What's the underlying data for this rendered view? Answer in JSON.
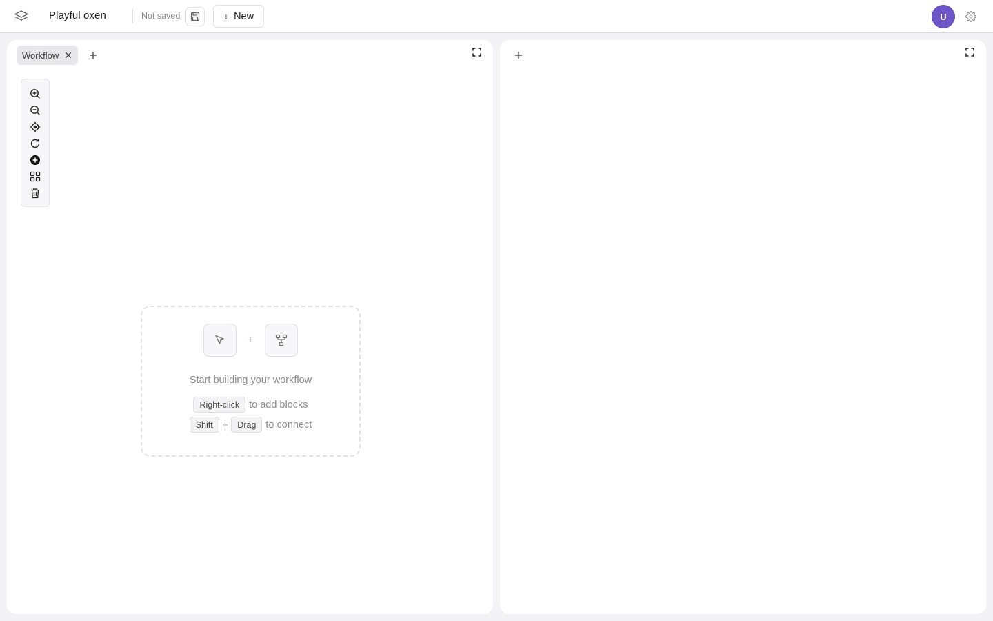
{
  "header": {
    "logo_icon": "layers-icon",
    "project_name": "Playful oxen",
    "save_status": "Not saved",
    "save_icon": "floppy-disk-icon",
    "new_button_label": "New",
    "new_button_icon": "plus-icon",
    "avatar_initial": "U",
    "avatar_color": "#6f56c9",
    "settings_icon": "gear-icon"
  },
  "left_panel": {
    "tabs": [
      {
        "label": "Workflow",
        "close_icon": "close-icon"
      }
    ],
    "add_tab_icon": "plus-icon",
    "expand_icon": "fullscreen-icon",
    "toolbar": [
      {
        "name": "zoom-in",
        "icon": "zoom-in-icon"
      },
      {
        "name": "zoom-out",
        "icon": "zoom-out-icon"
      },
      {
        "name": "center",
        "icon": "crosshair-icon"
      },
      {
        "name": "reset",
        "icon": "refresh-icon"
      },
      {
        "name": "add-block",
        "icon": "add-circle-icon"
      },
      {
        "name": "auto-layout",
        "icon": "grid-icon"
      },
      {
        "name": "clear",
        "icon": "trash-icon"
      }
    ],
    "empty_state": {
      "title": "Start building your workflow",
      "hint1": {
        "key": "Right-click",
        "text": "to add blocks"
      },
      "hint2": {
        "key1": "Shift",
        "plus": "+",
        "key2": "Drag",
        "text": "to connect"
      },
      "plus": "+"
    }
  },
  "right_panel": {
    "add_tab_icon": "plus-icon",
    "expand_icon": "fullscreen-icon"
  }
}
